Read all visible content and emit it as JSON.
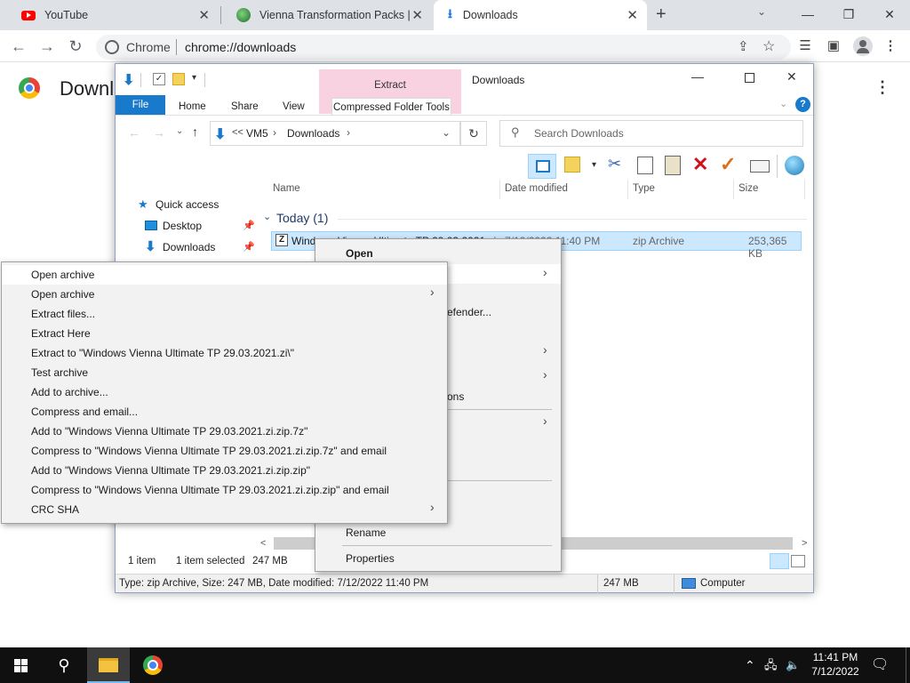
{
  "chrome": {
    "tabs": [
      {
        "title": "YouTube",
        "icon": "youtube-icon",
        "active": false
      },
      {
        "title": "Vienna Transformation Packs | Vi",
        "icon": "globe-icon",
        "active": false
      },
      {
        "title": "Downloads",
        "icon": "download-icon",
        "active": true
      }
    ],
    "new_tab": "+",
    "omnibox_site": "Chrome",
    "omnibox_url": "chrome://downloads",
    "page_title": "Downl",
    "colors": {
      "tabbar": "#dee1e6",
      "youtube": "#ff0000"
    }
  },
  "explorer": {
    "window_title": "Downloads",
    "context_tab": "Extract",
    "ribbon_tabs": [
      "File",
      "Home",
      "Share",
      "View",
      "Compressed Folder Tools"
    ],
    "breadcrumb": [
      "<<",
      "VM5",
      "Downloads"
    ],
    "search_placeholder": "Search Downloads",
    "nav": {
      "quick_access": "Quick access",
      "desktop": "Desktop",
      "downloads": "Downloads"
    },
    "columns": [
      "Name",
      "Date modified",
      "Type",
      "Size"
    ],
    "group": "Today (1)",
    "file": {
      "name": "Windows Vienna Ultimate TP 29.03.2021.zi",
      "date": "7/12/2022 11:40 PM",
      "type": "zip Archive",
      "size": "253,365 KB"
    },
    "status_left": "1 item",
    "status_selected": "1 item selected",
    "status_size": "247 MB",
    "details_bar": "Type: zip Archive, Size: 247 MB, Date modified: 7/12/2022 11:40 PM",
    "details_size": "247 MB",
    "details_computer": "Computer",
    "colors": {
      "file_tab": "#1979ca",
      "context": "#f9d2e2",
      "selection": "#cce8ff"
    }
  },
  "context_menu": {
    "open": "Open",
    "defender_fragment": "efender...",
    "ons_fragment": "ons",
    "rename": "Rename",
    "properties": "Properties"
  },
  "submenu": {
    "items": [
      "Open archive",
      "Open archive",
      "Extract files...",
      "Extract Here",
      "Extract to \"Windows Vienna Ultimate TP 29.03.2021.zi\\\"",
      "Test archive",
      "Add to archive...",
      "Compress and email...",
      "Add to \"Windows Vienna Ultimate TP 29.03.2021.zi.zip.7z\"",
      "Compress to \"Windows Vienna Ultimate TP 29.03.2021.zi.zip.7z\" and email",
      "Add to \"Windows Vienna Ultimate TP 29.03.2021.zi.zip.zip\"",
      "Compress to \"Windows Vienna Ultimate TP 29.03.2021.zi.zip.zip\" and email",
      "CRC SHA"
    ]
  },
  "taskbar": {
    "time": "11:41 PM",
    "date": "7/12/2022"
  }
}
